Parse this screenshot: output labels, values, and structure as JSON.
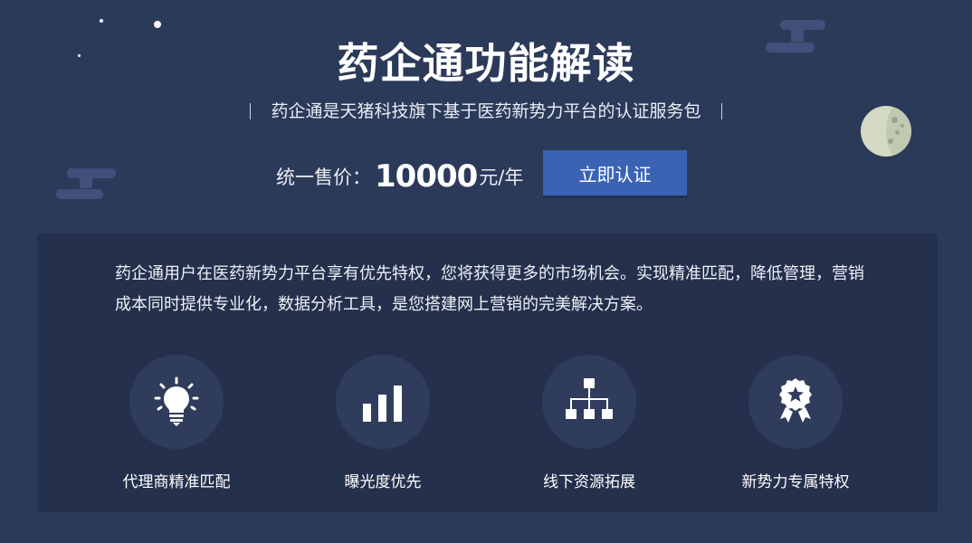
{
  "hero": {
    "title": "药企通功能解读",
    "subtitle": "药企通是天猪科技旗下基于医药新势力平台的认证服务包",
    "price_label": "统一售价：",
    "price_amount": "10000",
    "price_unit": "元/年",
    "cta_label": "立即认证"
  },
  "panel": {
    "description": "药企通用户在医药新势力平台享有优先特权，您将获得更多的市场机会。实现精准匹配，降低管理，营销成本同时提供专业化，数据分析工具，是您搭建网上营销的完美解决方案。",
    "features": [
      {
        "label": "代理商精准匹配",
        "icon": "lightbulb-icon"
      },
      {
        "label": "曝光度优先",
        "icon": "bar-chart-icon"
      },
      {
        "label": "线下资源拓展",
        "icon": "org-chart-icon"
      },
      {
        "label": "新势力专属特权",
        "icon": "award-badge-icon"
      }
    ]
  },
  "colors": {
    "background": "#2c3a59",
    "panel": "#24304c",
    "icon_circle": "#2f3c5c",
    "button": "#3a63b4"
  }
}
